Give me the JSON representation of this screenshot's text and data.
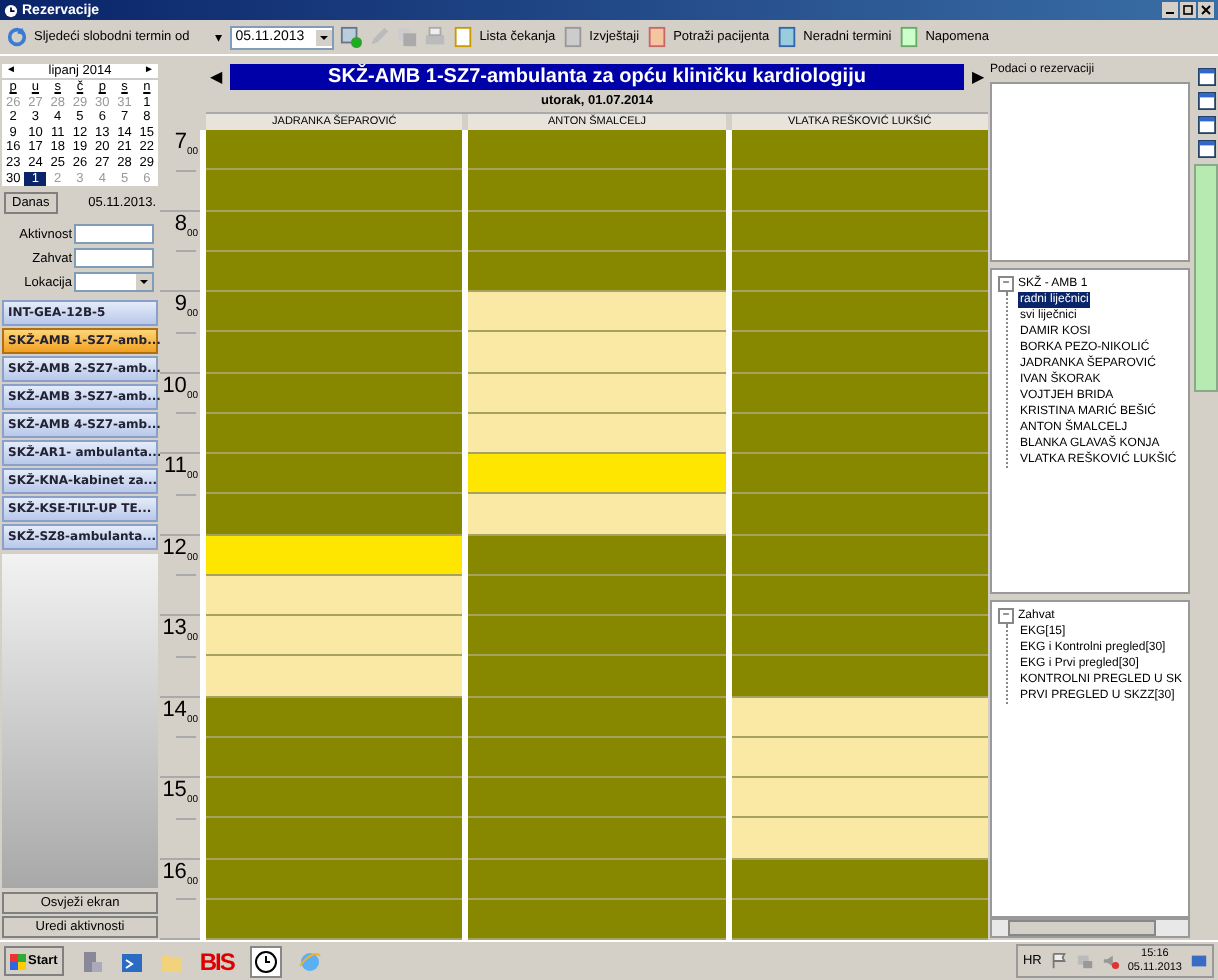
{
  "window": {
    "title": "Rezervacije"
  },
  "toolbar": {
    "next_free_label": "Sljedeći slobodni termin od",
    "next_free_arrow": "▾",
    "date": "05.11.2013",
    "items": [
      "Lista čekanja",
      "Izvještaji",
      "Potraži pacijenta",
      "Neradni termini",
      "Napomena"
    ]
  },
  "mini_calendar": {
    "prev": "◄",
    "month": "lipanj 2014",
    "next": "►",
    "weekdays": [
      "p",
      "u",
      "s",
      "č",
      "p",
      "s",
      "n"
    ],
    "days": [
      {
        "label": "26",
        "muted": true,
        "selected": false
      },
      {
        "label": "27",
        "muted": true,
        "selected": false
      },
      {
        "label": "28",
        "muted": true,
        "selected": false
      },
      {
        "label": "29",
        "muted": true,
        "selected": false
      },
      {
        "label": "30",
        "muted": true,
        "selected": false
      },
      {
        "label": "31",
        "muted": true,
        "selected": false
      },
      {
        "label": "1",
        "muted": false,
        "selected": false
      },
      {
        "label": "2",
        "muted": false,
        "selected": false
      },
      {
        "label": "3",
        "muted": false,
        "selected": false
      },
      {
        "label": "4",
        "muted": false,
        "selected": false
      },
      {
        "label": "5",
        "muted": false,
        "selected": false
      },
      {
        "label": "6",
        "muted": false,
        "selected": false
      },
      {
        "label": "7",
        "muted": false,
        "selected": false
      },
      {
        "label": "8",
        "muted": false,
        "selected": false
      },
      {
        "label": "9",
        "muted": false,
        "selected": false
      },
      {
        "label": "10",
        "muted": false,
        "selected": false
      },
      {
        "label": "11",
        "muted": false,
        "selected": false
      },
      {
        "label": "12",
        "muted": false,
        "selected": false
      },
      {
        "label": "13",
        "muted": false,
        "selected": false
      },
      {
        "label": "14",
        "muted": false,
        "selected": false
      },
      {
        "label": "15",
        "muted": false,
        "selected": false
      },
      {
        "label": "16",
        "muted": false,
        "selected": false
      },
      {
        "label": "17",
        "muted": false,
        "selected": false
      },
      {
        "label": "18",
        "muted": false,
        "selected": false
      },
      {
        "label": "19",
        "muted": false,
        "selected": false
      },
      {
        "label": "20",
        "muted": false,
        "selected": false
      },
      {
        "label": "21",
        "muted": false,
        "selected": false
      },
      {
        "label": "22",
        "muted": false,
        "selected": false
      },
      {
        "label": "23",
        "muted": false,
        "selected": false
      },
      {
        "label": "24",
        "muted": false,
        "selected": false
      },
      {
        "label": "25",
        "muted": false,
        "selected": false
      },
      {
        "label": "26",
        "muted": false,
        "selected": false
      },
      {
        "label": "27",
        "muted": false,
        "selected": false
      },
      {
        "label": "28",
        "muted": false,
        "selected": false
      },
      {
        "label": "29",
        "muted": false,
        "selected": false
      },
      {
        "label": "30",
        "muted": false,
        "selected": false
      },
      {
        "label": "1",
        "muted": true,
        "selected": true
      },
      {
        "label": "2",
        "muted": true,
        "selected": false
      },
      {
        "label": "3",
        "muted": true,
        "selected": false
      },
      {
        "label": "4",
        "muted": true,
        "selected": false
      },
      {
        "label": "5",
        "muted": true,
        "selected": false
      },
      {
        "label": "6",
        "muted": true,
        "selected": false
      }
    ],
    "today_button": "Danas",
    "today_date": "05.11.2013."
  },
  "filters": [
    {
      "kind": "text",
      "label": "Aktivnost"
    },
    {
      "kind": "text",
      "label": "Zahvat"
    },
    {
      "kind": "select",
      "label": "Lokacija"
    }
  ],
  "clinics": [
    {
      "label": "INT-GEA-12B-5",
      "selected": false
    },
    {
      "label": "SKŽ-AMB 1-SZ7-amb...",
      "selected": true
    },
    {
      "label": "SKŽ-AMB 2-SZ7-amb...",
      "selected": false
    },
    {
      "label": "SKŽ-AMB 3-SZ7-amb...",
      "selected": false
    },
    {
      "label": "SKŽ-AMB 4-SZ7-amb...",
      "selected": false
    },
    {
      "label": "SKŽ-AR1- ambulanta...",
      "selected": false
    },
    {
      "label": "SKŽ-KNA-kabinet za...",
      "selected": false
    },
    {
      "label": "SKŽ-KSE-TILT-UP TE...",
      "selected": false
    },
    {
      "label": "SKŽ-SZ8-ambulanta...",
      "selected": false
    }
  ],
  "left_buttons": [
    "Osvježi ekran",
    "Uredi aktivnosti"
  ],
  "schedule": {
    "prev": "◀",
    "title": "SKŽ-AMB 1-SZ7-ambulanta za opću kliničku kardiologiju",
    "next": "▶",
    "date": "utorak, 01.07.2014",
    "hours": [
      {
        "hour": "7",
        "minutes": "00"
      },
      {
        "hour": "8",
        "minutes": "00"
      },
      {
        "hour": "9",
        "minutes": "00"
      },
      {
        "hour": "10",
        "minutes": "00"
      },
      {
        "hour": "11",
        "minutes": "00"
      },
      {
        "hour": "12",
        "minutes": "00"
      },
      {
        "hour": "13",
        "minutes": "00"
      },
      {
        "hour": "14",
        "minutes": "00"
      },
      {
        "hour": "15",
        "minutes": "00"
      },
      {
        "hour": "16",
        "minutes": "00"
      }
    ],
    "columns": [
      {
        "name": "JADRANKA ŠEPAROVIĆ",
        "slots": [
          {
            "kind": "busy"
          },
          {
            "kind": "busy"
          },
          {
            "kind": "busy"
          },
          {
            "kind": "busy"
          },
          {
            "kind": "busy"
          },
          {
            "kind": "busy"
          },
          {
            "kind": "busy"
          },
          {
            "kind": "busy"
          },
          {
            "kind": "busy"
          },
          {
            "kind": "busy"
          },
          {
            "kind": "highlighted"
          },
          {
            "kind": "free"
          },
          {
            "kind": "free"
          },
          {
            "kind": "free"
          },
          {
            "kind": "busy"
          },
          {
            "kind": "busy"
          },
          {
            "kind": "busy"
          },
          {
            "kind": "busy"
          },
          {
            "kind": "busy"
          },
          {
            "kind": "busy"
          }
        ]
      },
      {
        "name": "ANTON ŠMALCELJ",
        "slots": [
          {
            "kind": "busy"
          },
          {
            "kind": "busy"
          },
          {
            "kind": "busy"
          },
          {
            "kind": "busy"
          },
          {
            "kind": "free"
          },
          {
            "kind": "free"
          },
          {
            "kind": "free"
          },
          {
            "kind": "free"
          },
          {
            "kind": "highlighted"
          },
          {
            "kind": "free"
          },
          {
            "kind": "busy"
          },
          {
            "kind": "busy"
          },
          {
            "kind": "busy"
          },
          {
            "kind": "busy"
          },
          {
            "kind": "busy"
          },
          {
            "kind": "busy"
          },
          {
            "kind": "busy"
          },
          {
            "kind": "busy"
          },
          {
            "kind": "busy"
          },
          {
            "kind": "busy"
          }
        ]
      },
      {
        "name": "VLATKA REŠKOVIĆ LUKŠIĆ",
        "slots": [
          {
            "kind": "busy"
          },
          {
            "kind": "busy"
          },
          {
            "kind": "busy"
          },
          {
            "kind": "busy"
          },
          {
            "kind": "busy"
          },
          {
            "kind": "busy"
          },
          {
            "kind": "busy"
          },
          {
            "kind": "busy"
          },
          {
            "kind": "busy"
          },
          {
            "kind": "busy"
          },
          {
            "kind": "busy"
          },
          {
            "kind": "busy"
          },
          {
            "kind": "busy"
          },
          {
            "kind": "busy"
          },
          {
            "kind": "free"
          },
          {
            "kind": "free"
          },
          {
            "kind": "free"
          },
          {
            "kind": "free"
          },
          {
            "kind": "busy"
          },
          {
            "kind": "busy"
          }
        ]
      }
    ]
  },
  "right_panel": {
    "details_label": "Podaci o rezervaciji",
    "doctor_tree": {
      "toggle": "−",
      "label": "SKŽ - AMB 1",
      "expanded": true,
      "children": [
        {
          "label": "radni liječnici",
          "selected": true
        },
        {
          "label": "svi liječnici",
          "selected": false
        },
        {
          "label": "DAMIR KOSI",
          "selected": false
        },
        {
          "label": "BORKA PEZO-NIKOLIĆ",
          "selected": false
        },
        {
          "label": "JADRANKA ŠEPAROVIĆ",
          "selected": false
        },
        {
          "label": "IVAN ŠKORAK",
          "selected": false
        },
        {
          "label": "VOJTJEH BRIDA",
          "selected": false
        },
        {
          "label": "KRISTINA MARIĆ BEŠIĆ",
          "selected": false
        },
        {
          "label": "ANTON ŠMALCELJ",
          "selected": false
        },
        {
          "label": "BLANKA GLAVAŠ KONJA",
          "selected": false
        },
        {
          "label": "VLATKA REŠKOVIĆ LUKŠIĆ",
          "selected": false
        }
      ]
    },
    "procedure_tree": {
      "toggle": "−",
      "label": "Zahvat",
      "expanded": true,
      "children": [
        {
          "label": "EKG[15]",
          "selected": false
        },
        {
          "label": "EKG i Kontrolni pregled[30]",
          "selected": false
        },
        {
          "label": "EKG i Prvi pregled[30]",
          "selected": false
        },
        {
          "label": "KONTROLNI PREGLED U SK",
          "selected": false
        },
        {
          "label": "PRVI PREGLED U SKZZ[30]",
          "selected": false
        }
      ]
    }
  },
  "taskbar": {
    "start": "Start",
    "bis": "BIS",
    "language": "HR",
    "time": "15:16",
    "date": "05.11.2013"
  }
}
